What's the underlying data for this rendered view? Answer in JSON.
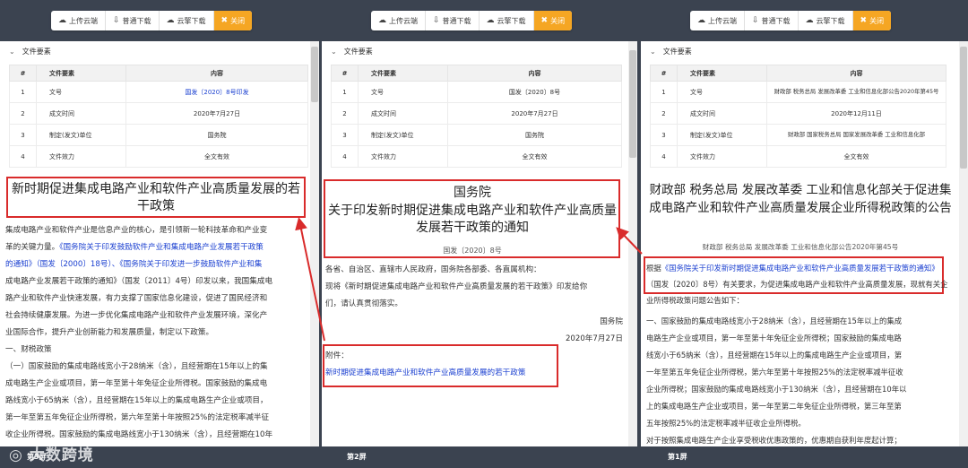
{
  "toolbar": {
    "upload": "上传云端",
    "normal_download": "普通下载",
    "cloud_download": "云擎下载",
    "close": "关闭"
  },
  "section_title": "文件要素",
  "table_headers": [
    "#",
    "文件要素",
    "内容"
  ],
  "pane1": {
    "rows": [
      {
        "n": "1",
        "k": "文号",
        "v": "国发〔2020〕8号印发"
      },
      {
        "n": "2",
        "k": "成文时间",
        "v": "2020年7月27日"
      },
      {
        "n": "3",
        "k": "制定(发文)单位",
        "v": "国务院"
      },
      {
        "n": "4",
        "k": "文件效力",
        "v": "全文有效"
      }
    ],
    "title": "新时期促进集成电路产业和软件产业高质量发展的若干政策",
    "body_lines": [
      "集成电路产业和软件产业是信息产业的核心，是引领新一轮科技革命和产业变",
      "革的关键力量。",
      "《国务院关于印发鼓励软件产业和集成电路产业发展若干政策",
      "的通知》（国发〔2000〕18号）、",
      "《国务院关于印发进一步鼓励软件产业和集",
      "成电路产业发展若干政策的通知》（国发〔2011〕4号）印发以来，我国集成电",
      "路产业和软件产业快速发展，有力支撑了国家信息化建设，促进了国民经济和",
      "社会持续健康发展。为进一步优化集成电路产业和软件产业发展环境，深化产",
      "业国际合作，提升产业创新能力和发展质量，制定以下政策。",
      "一、财税政策",
      "（一）国家鼓励的集成电路线宽小于28纳米（含），且经营期在15年以上的集",
      "成电路生产企业或项目，第一年至第十年免征企业所得税。国家鼓励的集成电",
      "路线宽小于65纳米（含），且经营期在15年以上的集成电路生产企业或项目，",
      "第一年至第五年免征企业所得税，第六年至第十年按照25%的法定税率减半征",
      "收企业所得税。国家鼓励的集成电路线宽小于130纳米（含），且经营期在10年"
    ],
    "label": "第3屏"
  },
  "pane2": {
    "rows": [
      {
        "n": "1",
        "k": "文号",
        "v": "国发〔2020〕8号"
      },
      {
        "n": "2",
        "k": "成文时间",
        "v": "2020年7月27日"
      },
      {
        "n": "3",
        "k": "制定(发文)单位",
        "v": "国务院"
      },
      {
        "n": "4",
        "k": "文件效力",
        "v": "全文有效"
      }
    ],
    "org": "国务院",
    "title": "关于印发新时期促进集成电路产业和软件产业高质量发展若干政策的通知",
    "doc_no": "国发〔2020〕8号",
    "line1": "各省、自治区、直辖市人民政府，国务院各部委、各直属机构：",
    "line2": "现将《新时期促进集成电路产业和软件产业高质量发展的若干政策》印发给你",
    "line3": "们，请认真贯彻落实。",
    "sign_org": "国务院",
    "sign_date": "2020年7月27日",
    "attach_label": "附件：",
    "attach_link": "新时期促进集成电路产业和软件产业高质量发展的若干政策",
    "label": "第2屏"
  },
  "pane3": {
    "rows": [
      {
        "n": "1",
        "k": "文号",
        "v": "财政部 税务总局 发展改革委 工业和信息化部公告2020年第45号"
      },
      {
        "n": "2",
        "k": "成文时间",
        "v": "2020年12月11日"
      },
      {
        "n": "3",
        "k": "制定(发文)单位",
        "v": "财政部 国家税务总局 国家发展改革委 工业和信息化部"
      },
      {
        "n": "4",
        "k": "文件效力",
        "v": "全文有效"
      }
    ],
    "title": "财政部 税务总局 发展改革委 工业和信息化部关于促进集成电路产业和软件产业高质量发展企业所得税政策的公告",
    "subtitle": "财政部 税务总局 发展改革委 工业和信息化部公告2020年第45号",
    "body_lead": "根据",
    "body_link": "《国务院关于印发新时期促进集成电路产业和软件产业高质量发展若干政策的通知》",
    "body_tail": "（国发〔2020〕8号）有关要求，为促进集成电路产业和软件产业高质量发展，现就有关企业所得税政策问题公告如下：",
    "body_lines": [
      "一、国家鼓励的集成电路线宽小于28纳米（含），且经营期在15年以上的集成",
      "电路生产企业或项目，第一年至第十年免征企业所得税；国家鼓励的集成电路",
      "线宽小于65纳米（含），且经营期在15年以上的集成电路生产企业或项目，第",
      "一年至第五年免征企业所得税，第六年至第十年按照25%的法定税率减半征收",
      "企业所得税；国家鼓励的集成电路线宽小于130纳米（含），且经营期在10年以",
      "上的集成电路生产企业或项目，第一年至第二年免征企业所得税，第三年至第",
      "五年按照25%的法定税率减半征收企业所得税。",
      "对于按照集成电路生产企业享受税收优惠政策的，优惠期自获利年度起计算；"
    ],
    "label": "第1屏"
  },
  "watermark": "大数跨境"
}
